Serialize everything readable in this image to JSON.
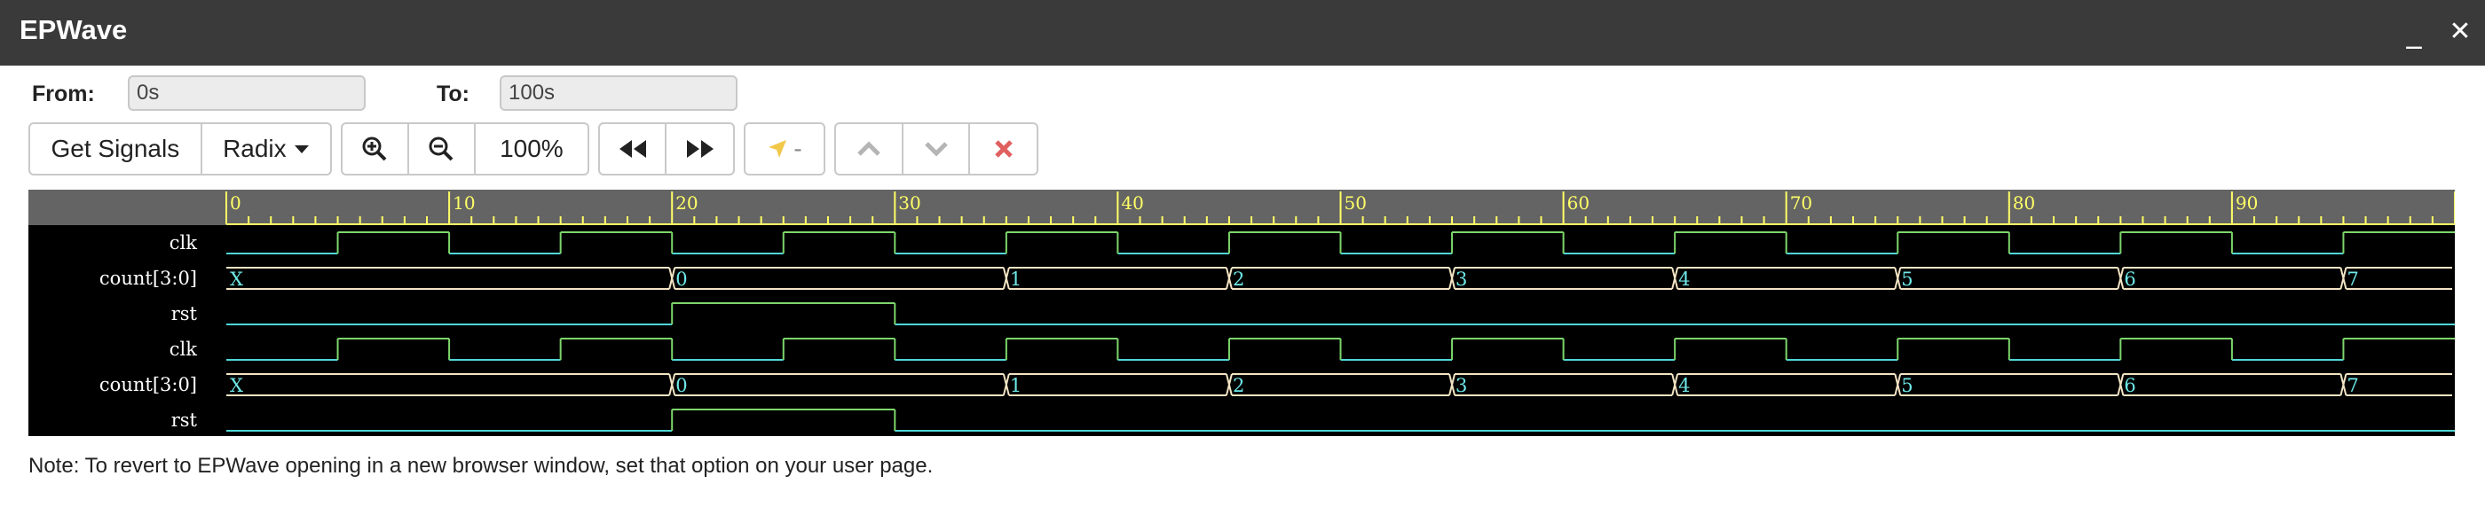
{
  "app": {
    "title": "EPWave",
    "minimize": "_",
    "close": "✕"
  },
  "range": {
    "from_label": "From:",
    "from_value": "0s",
    "to_label": "To:",
    "to_value": "100s"
  },
  "toolbar": {
    "get_signals": "Get Signals",
    "radix": "Radix",
    "zoom_level": "100%",
    "cursor_value": "-",
    "icons": [
      "zoom-in-icon",
      "zoom-out-icon",
      "rewind-icon",
      "fast-forward-icon",
      "cursor-icon",
      "up-icon",
      "down-icon",
      "delete-icon"
    ]
  },
  "timeline": {
    "start": 0,
    "end": 100,
    "major_labels": [
      "0",
      "10",
      "20",
      "30",
      "40",
      "50",
      "60",
      "70",
      "80",
      "90"
    ]
  },
  "signals": [
    {
      "name": "clk",
      "type": "clock",
      "period": 10,
      "first_high": 5
    },
    {
      "name": "count[3:0]",
      "type": "bus",
      "segments": [
        {
          "t": 0,
          "label": "X"
        },
        {
          "t": 20,
          "label": "0"
        },
        {
          "t": 35,
          "label": "1"
        },
        {
          "t": 45,
          "label": "2"
        },
        {
          "t": 55,
          "label": "3"
        },
        {
          "t": 65,
          "label": "4"
        },
        {
          "t": 75,
          "label": "5"
        },
        {
          "t": 85,
          "label": "6"
        },
        {
          "t": 95,
          "label": "7"
        }
      ]
    },
    {
      "name": "rst",
      "type": "bit",
      "high_intervals": [
        [
          20,
          30
        ]
      ]
    },
    {
      "name": "clk",
      "type": "clock",
      "period": 10,
      "first_high": 5
    },
    {
      "name": "count[3:0]",
      "type": "bus",
      "segments": [
        {
          "t": 0,
          "label": "X"
        },
        {
          "t": 20,
          "label": "0"
        },
        {
          "t": 35,
          "label": "1"
        },
        {
          "t": 45,
          "label": "2"
        },
        {
          "t": 55,
          "label": "3"
        },
        {
          "t": 65,
          "label": "4"
        },
        {
          "t": 75,
          "label": "5"
        },
        {
          "t": 85,
          "label": "6"
        },
        {
          "t": 95,
          "label": "7"
        }
      ]
    },
    {
      "name": "rst",
      "type": "bit",
      "high_intervals": [
        [
          20,
          30
        ]
      ]
    }
  ],
  "colors": {
    "high": "#7dd66b",
    "low": "#4fd6d6",
    "bus": "#f2e4c4",
    "bus_text": "#6fe8e8",
    "ruler": "#ffff66",
    "ruler_bg": "#646464",
    "signal_text": "#ffffff"
  },
  "note": "Note: To revert to EPWave opening in a new browser window, set that option on your user page."
}
